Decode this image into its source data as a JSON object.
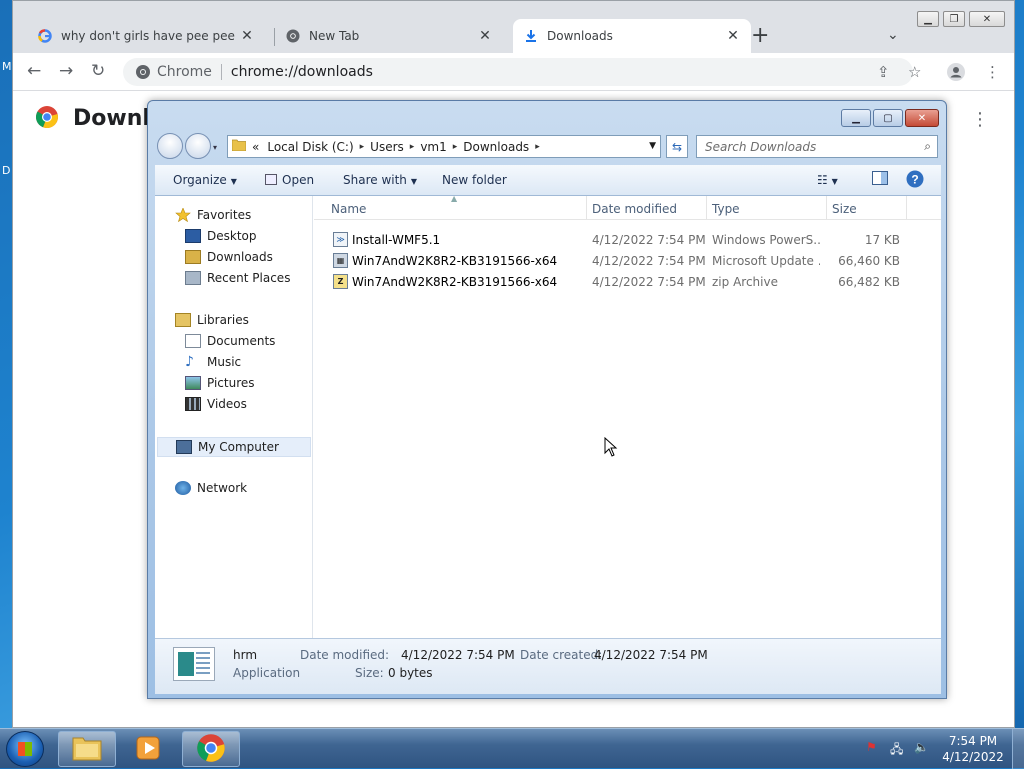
{
  "desktop": {
    "fragment_left_top": "M",
    "fragment_left_mid": "D"
  },
  "chrome": {
    "tabs": [
      {
        "title": "why don't girls have pee pee - G",
        "favicon": "google-icon"
      },
      {
        "title": "New Tab",
        "favicon": "chrome-icon"
      },
      {
        "title": "Downloads",
        "favicon": "download-icon"
      }
    ],
    "new_tab_label": "+",
    "omnibox": {
      "site": "Chrome",
      "url": "chrome://downloads"
    },
    "page_title": "Downloads"
  },
  "explorer": {
    "breadcrumb": [
      "Local Disk (C:)",
      "Users",
      "vm1",
      "Downloads"
    ],
    "breadcrumb_prefix": "«",
    "search_placeholder": "Search Downloads",
    "toolbar": {
      "organize": "Organize",
      "open": "Open",
      "share_with": "Share with",
      "new_folder": "New folder"
    },
    "nav": {
      "favorites": "Favorites",
      "desktop": "Desktop",
      "downloads": "Downloads",
      "recent_places": "Recent Places",
      "libraries": "Libraries",
      "documents": "Documents",
      "music": "Music",
      "pictures": "Pictures",
      "videos": "Videos",
      "my_computer": "My Computer",
      "network": "Network"
    },
    "columns": {
      "name": "Name",
      "date": "Date modified",
      "type": "Type",
      "size": "Size"
    },
    "files": [
      {
        "name": "Install-WMF5.1",
        "date": "4/12/2022 7:54 PM",
        "type": "Windows PowerS...",
        "size": "17 KB",
        "icon": "powershell-script-icon"
      },
      {
        "name": "Win7AndW2K8R2-KB3191566-x64",
        "date": "4/12/2022 7:54 PM",
        "type": "Microsoft Update ...",
        "size": "66,460 KB",
        "icon": "msu-package-icon"
      },
      {
        "name": "Win7AndW2K8R2-KB3191566-x64",
        "date": "4/12/2022 7:54 PM",
        "type": "zip Archive",
        "size": "66,482 KB",
        "icon": "zip-archive-icon"
      }
    ],
    "details": {
      "name": "hrm",
      "kind": "Application",
      "date_modified_label": "Date modified:",
      "date_modified": "4/12/2022 7:54 PM",
      "date_created_label": "Date created:",
      "date_created": "4/12/2022 7:54 PM",
      "size_label": "Size:",
      "size": "0 bytes"
    }
  },
  "taskbar": {
    "time": "7:54 PM",
    "date": "4/12/2022"
  }
}
